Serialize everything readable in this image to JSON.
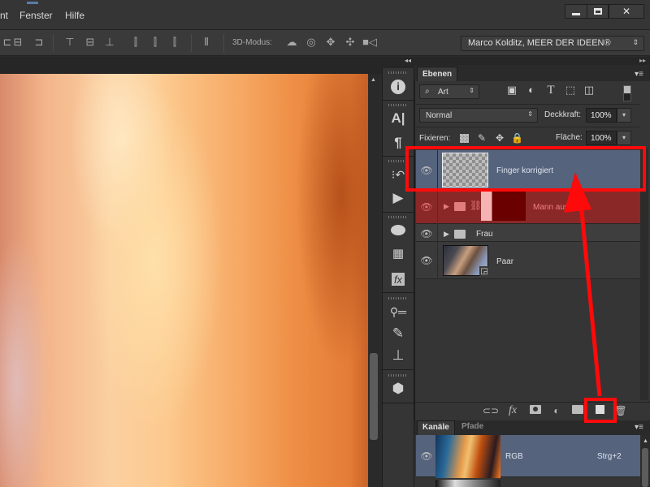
{
  "menubar": {
    "items": [
      {
        "label": "nt"
      },
      {
        "label": "Fenster"
      },
      {
        "label": "Hilfe"
      }
    ],
    "window_controls": {
      "minimize": "▁",
      "maximize": "☐",
      "close": "✕"
    }
  },
  "options_bar": {
    "align_icons": [
      "align-horizontal-left-icon",
      "align-horizontal-center-icon",
      "align-right-edge-icon",
      "align-top-icon",
      "align-vertical-center-icon",
      "align-bottom-icon",
      "distribute-left-icon",
      "distribute-horizontal-center-icon",
      "distribute-right-icon",
      "auto-align-icon"
    ],
    "mode_label": "3D-Modus:",
    "mode_icons": [
      "rotate-3d-icon",
      "roll-3d-icon",
      "drag-3d-icon",
      "slide-3d-icon",
      "scale-3d-icon"
    ],
    "workspace": "Marco Kolditz, MEER DER IDEEN®"
  },
  "dock": {
    "collapse_icon": "◂◂",
    "icons": [
      {
        "name": "info-icon",
        "glyph": "ℹ"
      },
      {
        "name": "character-icon",
        "glyph": "A|"
      },
      {
        "name": "paragraph-icon",
        "glyph": "¶"
      },
      {
        "name": "history-icon",
        "glyph": "⁝↶"
      },
      {
        "name": "actions-icon",
        "glyph": "▶"
      },
      {
        "name": "color-palette-icon",
        "glyph": "🎨"
      },
      {
        "name": "swatches-icon",
        "glyph": "▦"
      },
      {
        "name": "styles-icon",
        "glyph": "fx"
      },
      {
        "name": "brush-presets-icon",
        "glyph": "⚲"
      },
      {
        "name": "brushes-icon",
        "glyph": "✎"
      },
      {
        "name": "clone-source-icon",
        "glyph": "⊥"
      },
      {
        "name": "3d-icon",
        "glyph": "⬢"
      }
    ]
  },
  "layers_panel": {
    "tab": "Ebenen",
    "filter_kind": "Art",
    "filter_icons": [
      "image-filter-icon",
      "adjustment-filter-icon",
      "type-filter-icon",
      "shape-filter-icon",
      "smart-object-filter-icon"
    ],
    "blend_mode": "Normal",
    "opacity_label": "Deckkraft:",
    "opacity_value": "100%",
    "lock_label": "Fixieren:",
    "fill_label": "Fläche:",
    "fill_value": "100%",
    "layers": [
      {
        "name": "Finger korrigiert",
        "type": "pixel",
        "visible": true,
        "selected": true
      },
      {
        "name": "Mann aus",
        "type": "group-with-mask",
        "visible": true,
        "color_label": "red"
      },
      {
        "name": "Frau",
        "type": "group",
        "visible": true
      },
      {
        "name": "Paar",
        "type": "smart-object",
        "visible": true
      }
    ],
    "footer_icons": [
      "link-layers-icon",
      "fx-icon",
      "add-mask-icon",
      "adjustment-layer-icon",
      "new-group-icon",
      "new-layer-icon",
      "delete-layer-icon"
    ]
  },
  "channels_panel": {
    "tabs": [
      {
        "label": "Kanäle",
        "active": true
      },
      {
        "label": "Pfade",
        "active": false
      }
    ],
    "channels": [
      {
        "name": "RGB",
        "shortcut": "Strg+2",
        "visible": true
      }
    ]
  },
  "annotations": {
    "highlight_color": "#ff0a0a",
    "description": "Red frame around new layer button with arrow pointing up to highlighted 'Finger korrigiert' layer"
  }
}
